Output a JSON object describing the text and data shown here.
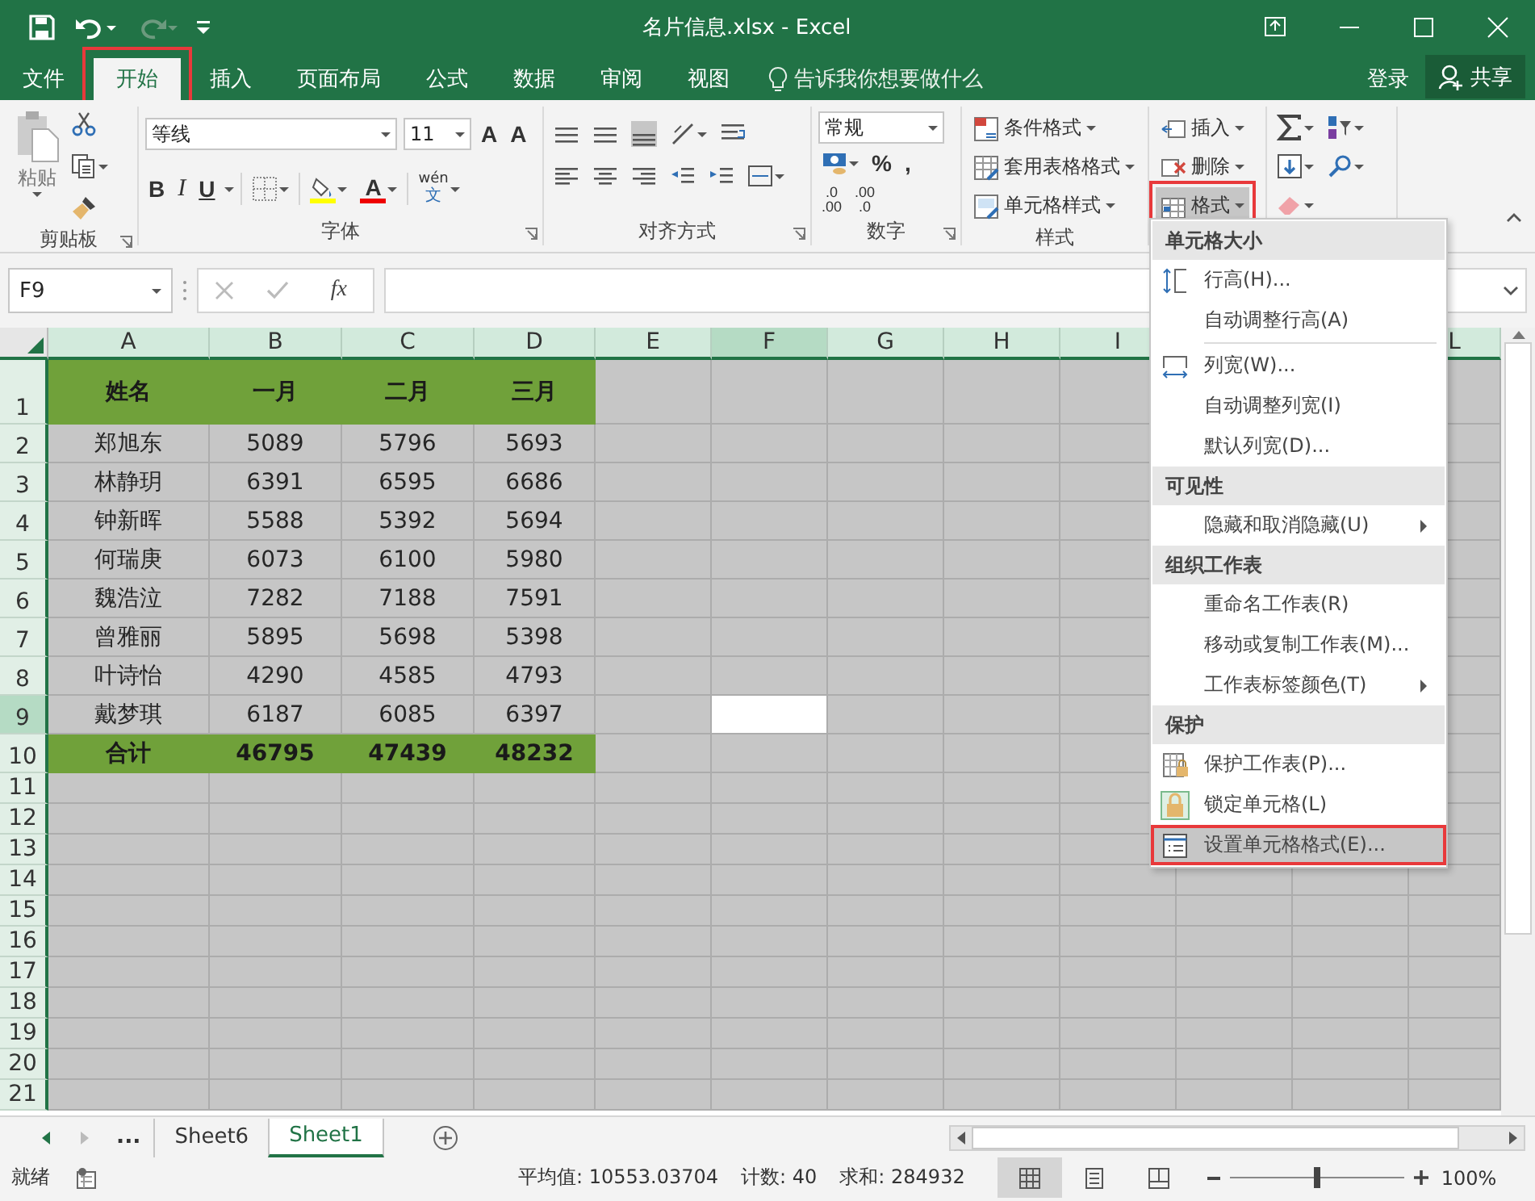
{
  "title_bar": {
    "title": "名片信息.xlsx - Excel"
  },
  "tabs": [
    {
      "label": "文件",
      "selected": false,
      "highlighted": false
    },
    {
      "label": "开始",
      "selected": true,
      "highlighted": true
    },
    {
      "label": "插入",
      "selected": false,
      "highlighted": false
    },
    {
      "label": "页面布局",
      "selected": false,
      "highlighted": false
    },
    {
      "label": "公式",
      "selected": false,
      "highlighted": false
    },
    {
      "label": "数据",
      "selected": false,
      "highlighted": false
    },
    {
      "label": "审阅",
      "selected": false,
      "highlighted": false
    },
    {
      "label": "视图",
      "selected": false,
      "highlighted": false
    }
  ],
  "tell_me": {
    "placeholder": "告诉我你想要做什么"
  },
  "sign_in": "登录",
  "share": "共享",
  "ribbon": {
    "clipboard": {
      "paste": "粘贴",
      "label": "剪贴板"
    },
    "font": {
      "font_name": "等线",
      "font_size": "11",
      "grow": "A",
      "shrink": "A",
      "bold": "B",
      "italic": "I",
      "underline": "U",
      "font_color": "A",
      "phonetic_top": "wén",
      "phonetic_bottom": "文",
      "label": "字体"
    },
    "alignment": {
      "label": "对齐方式"
    },
    "number": {
      "format": "常规",
      "percent": "%",
      "comma": ",",
      "increase_decimal": {
        "top": ".0",
        "bottom": ".00"
      },
      "decrease_decimal": {
        "top": ".00",
        "bottom": ".0"
      },
      "label": "数字"
    },
    "styles": {
      "buttons": [
        "条件格式",
        "套用表格格式",
        "单元格样式"
      ],
      "label": "样式"
    },
    "cells": {
      "buttons": [
        {
          "label": "插入",
          "pressed": false,
          "highlighted": false
        },
        {
          "label": "删除",
          "pressed": false,
          "highlighted": false
        },
        {
          "label": "格式",
          "pressed": true,
          "highlighted": true
        }
      ]
    }
  },
  "formula_bar": {
    "name_box": "F9",
    "function_label": "fx"
  },
  "sheet": {
    "columns": [
      {
        "label": "A",
        "selected": false
      },
      {
        "label": "B",
        "selected": false
      },
      {
        "label": "C",
        "selected": false
      },
      {
        "label": "D",
        "selected": false
      },
      {
        "label": "E",
        "selected": false
      },
      {
        "label": "F",
        "selected": true
      },
      {
        "label": "G",
        "selected": false
      },
      {
        "label": "H",
        "selected": false
      },
      {
        "label": "I",
        "selected": false
      },
      {
        "label": "L",
        "selected": false
      }
    ],
    "rows": [
      {
        "number": "1",
        "kind": "header",
        "selected": false,
        "cells": [
          "姓名",
          "一月",
          "二月",
          "三月"
        ]
      },
      {
        "number": "2",
        "kind": "data",
        "selected": false,
        "cells": [
          "郑旭东",
          "5089",
          "5796",
          "5693"
        ]
      },
      {
        "number": "3",
        "kind": "data",
        "selected": false,
        "cells": [
          "林静玥",
          "6391",
          "6595",
          "6686"
        ]
      },
      {
        "number": "4",
        "kind": "data",
        "selected": false,
        "cells": [
          "钟新晖",
          "5588",
          "5392",
          "5694"
        ]
      },
      {
        "number": "5",
        "kind": "data",
        "selected": false,
        "cells": [
          "何瑞庚",
          "6073",
          "6100",
          "5980"
        ]
      },
      {
        "number": "6",
        "kind": "data",
        "selected": false,
        "cells": [
          "魏浩泣",
          "7282",
          "7188",
          "7591"
        ]
      },
      {
        "number": "7",
        "kind": "data",
        "selected": false,
        "cells": [
          "曾雅丽",
          "5895",
          "5698",
          "5398"
        ]
      },
      {
        "number": "8",
        "kind": "data",
        "selected": false,
        "cells": [
          "叶诗怡",
          "4290",
          "4585",
          "4793"
        ]
      },
      {
        "number": "9",
        "kind": "data",
        "selected": true,
        "cells": [
          "戴梦琪",
          "6187",
          "6085",
          "6397"
        ]
      },
      {
        "number": "10",
        "kind": "total",
        "selected": false,
        "cells": [
          "合计",
          "46795",
          "47439",
          "48232"
        ]
      },
      {
        "number": "11",
        "kind": "empty",
        "selected": false
      },
      {
        "number": "12",
        "kind": "empty",
        "selected": false
      },
      {
        "number": "13",
        "kind": "empty",
        "selected": false
      },
      {
        "number": "14",
        "kind": "empty",
        "selected": false
      },
      {
        "number": "15",
        "kind": "empty",
        "selected": false
      },
      {
        "number": "16",
        "kind": "empty",
        "selected": false
      },
      {
        "number": "17",
        "kind": "empty",
        "selected": false
      },
      {
        "number": "18",
        "kind": "empty",
        "selected": false
      },
      {
        "number": "19",
        "kind": "empty",
        "selected": false
      },
      {
        "number": "20",
        "kind": "empty",
        "selected": false
      },
      {
        "number": "21",
        "kind": "empty",
        "selected": false
      }
    ]
  },
  "format_menu": {
    "sections": [
      {
        "title": "单元格大小",
        "items": [
          {
            "kind": "row-height",
            "label": "行高(H)...",
            "submenu": false,
            "selected": false,
            "highlighted": false
          },
          {
            "kind": "plain",
            "label": "自动调整行高(A)",
            "submenu": false,
            "selected": false,
            "highlighted": false
          },
          {
            "kind": "separator"
          },
          {
            "kind": "column-width",
            "label": "列宽(W)...",
            "submenu": false,
            "selected": false,
            "highlighted": false
          },
          {
            "kind": "plain",
            "label": "自动调整列宽(I)",
            "submenu": false,
            "selected": false,
            "highlighted": false
          },
          {
            "kind": "plain",
            "label": "默认列宽(D)...",
            "submenu": false,
            "selected": false,
            "highlighted": false
          }
        ]
      },
      {
        "title": "可见性",
        "items": [
          {
            "kind": "plain",
            "label": "隐藏和取消隐藏(U)",
            "submenu": true,
            "selected": false,
            "highlighted": false
          }
        ]
      },
      {
        "title": "组织工作表",
        "items": [
          {
            "kind": "plain",
            "label": "重命名工作表(R)",
            "submenu": false,
            "selected": false,
            "highlighted": false
          },
          {
            "kind": "plain",
            "label": "移动或复制工作表(M)...",
            "submenu": false,
            "selected": false,
            "highlighted": false
          },
          {
            "kind": "plain",
            "label": "工作表标签颜色(T)",
            "submenu": true,
            "selected": false,
            "highlighted": false
          }
        ]
      },
      {
        "title": "保护",
        "items": [
          {
            "kind": "protect-sheet",
            "label": "保护工作表(P)...",
            "submenu": false,
            "selected": false,
            "highlighted": false
          },
          {
            "kind": "lock",
            "label": "锁定单元格(L)",
            "submenu": false,
            "selected": false,
            "highlighted": false
          },
          {
            "kind": "format-cells",
            "label": "设置单元格格式(E)...",
            "submenu": false,
            "selected": true,
            "highlighted": true
          }
        ]
      }
    ]
  },
  "sheet_tabs": {
    "more": "...",
    "tabs": [
      {
        "label": "Sheet6",
        "selected": false
      },
      {
        "label": "Sheet1",
        "selected": true
      }
    ]
  },
  "status_bar": {
    "ready": "就绪",
    "average": "平均值: 10553.03704",
    "count": "计数: 40",
    "sum": "求和: 284932",
    "views": [
      {
        "selected": true
      },
      {
        "selected": false
      },
      {
        "selected": false
      }
    ],
    "zoom": {
      "level": 0.5,
      "reading": "100%"
    }
  }
}
